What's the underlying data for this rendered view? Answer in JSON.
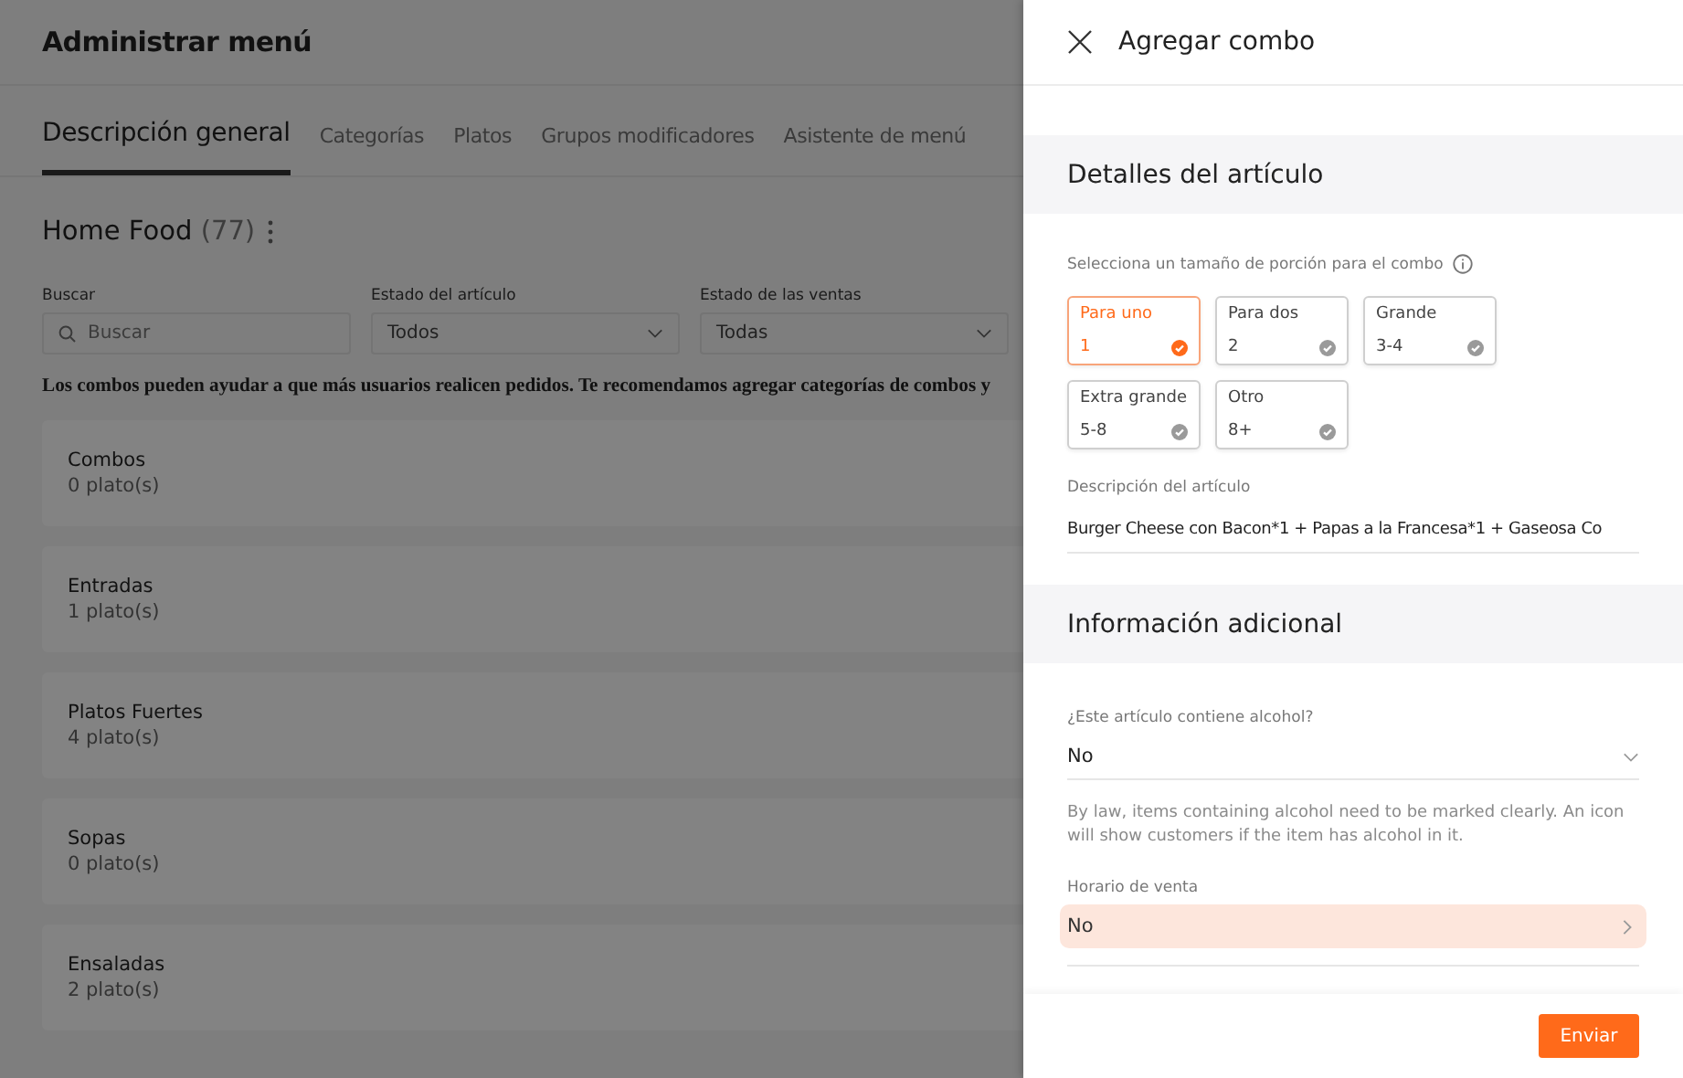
{
  "page": {
    "title": "Administrar menú",
    "tabs": [
      {
        "label": "Descripción general",
        "selected": true
      },
      {
        "label": "Categorías",
        "selected": false
      },
      {
        "label": "Platos",
        "selected": false
      },
      {
        "label": "Grupos modificadores",
        "selected": false
      },
      {
        "label": "Asistente de menú",
        "selected": false
      }
    ],
    "menu_name": "Home Food",
    "menu_count": "(77)",
    "filters": [
      {
        "kind": "search",
        "label": "Buscar",
        "placeholder": "Buscar"
      },
      {
        "kind": "select",
        "label": "Estado del artículo",
        "value": "Todos"
      },
      {
        "kind": "select",
        "label": "Estado de las ventas",
        "value": "Todas"
      }
    ],
    "notice": "Los combos pueden ayudar a que más usuarios realicen pedidos. Te recomendamos agregar categorías de combos y",
    "categories": [
      {
        "name": "Combos",
        "count": "0 plato(s)"
      },
      {
        "name": "Entradas",
        "count": "1 plato(s)"
      },
      {
        "name": "Platos Fuertes",
        "count": "4 plato(s)"
      },
      {
        "name": "Sopas",
        "count": "0 plato(s)"
      },
      {
        "name": "Ensaladas",
        "count": "2 plato(s)"
      }
    ]
  },
  "drawer": {
    "title": "Agregar combo",
    "details": {
      "heading": "Detalles del artículo",
      "portion_label": "Selecciona un tamaño de porción para el combo",
      "portions": [
        {
          "label": "Para uno",
          "size": "1",
          "selected": true
        },
        {
          "label": "Para dos",
          "size": "2",
          "selected": false
        },
        {
          "label": "Grande",
          "size": "3-4",
          "selected": false
        },
        {
          "label": "Extra grande",
          "size": "5-8",
          "selected": false
        },
        {
          "label": "Otro",
          "size": "8+",
          "selected": false
        }
      ],
      "description_label": "Descripción del artículo",
      "description_value": "Burger Cheese con Bacon*1 + Papas a la Francesa*1 + Gaseosa Co"
    },
    "additional": {
      "heading": "Información adicional",
      "alcohol_label": "¿Este artículo contiene alcohol?",
      "alcohol_value": "No",
      "alcohol_help": "By law, items containing alcohol need to be marked clearly. An icon will show customers if the item has alcohol in it.",
      "schedule_label": "Horario de venta",
      "schedule_value": "No"
    },
    "submit": "Enviar"
  }
}
